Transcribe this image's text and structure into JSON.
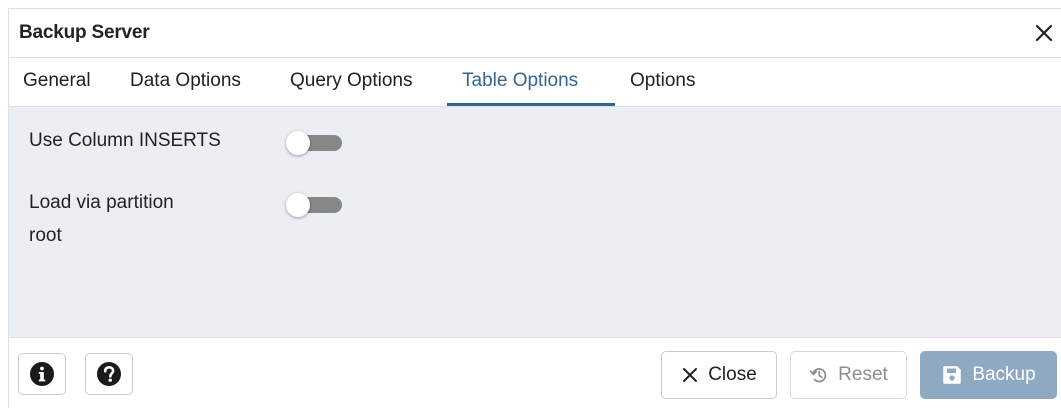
{
  "dialog": {
    "title": "Backup Server",
    "close_icon": "close-icon"
  },
  "tabs": [
    {
      "label": "General",
      "active": false
    },
    {
      "label": "Data Options",
      "active": false
    },
    {
      "label": "Query Options",
      "active": false
    },
    {
      "label": "Table Options",
      "active": true
    },
    {
      "label": "Options",
      "active": false
    }
  ],
  "fields": [
    {
      "label": "Use Column INSERTS",
      "enabled": false
    },
    {
      "label_line1": "Load via partition",
      "label_line2": "root",
      "enabled": false
    }
  ],
  "footer": {
    "info_icon": "info-icon",
    "help_icon": "help-icon",
    "close_label": "Close",
    "reset_label": "Reset",
    "backup_label": "Backup"
  },
  "colors": {
    "accent": "#326690",
    "content_bg": "#ebeef3",
    "toggle_off": "#888888",
    "backup_button": "#8fa9c3"
  }
}
